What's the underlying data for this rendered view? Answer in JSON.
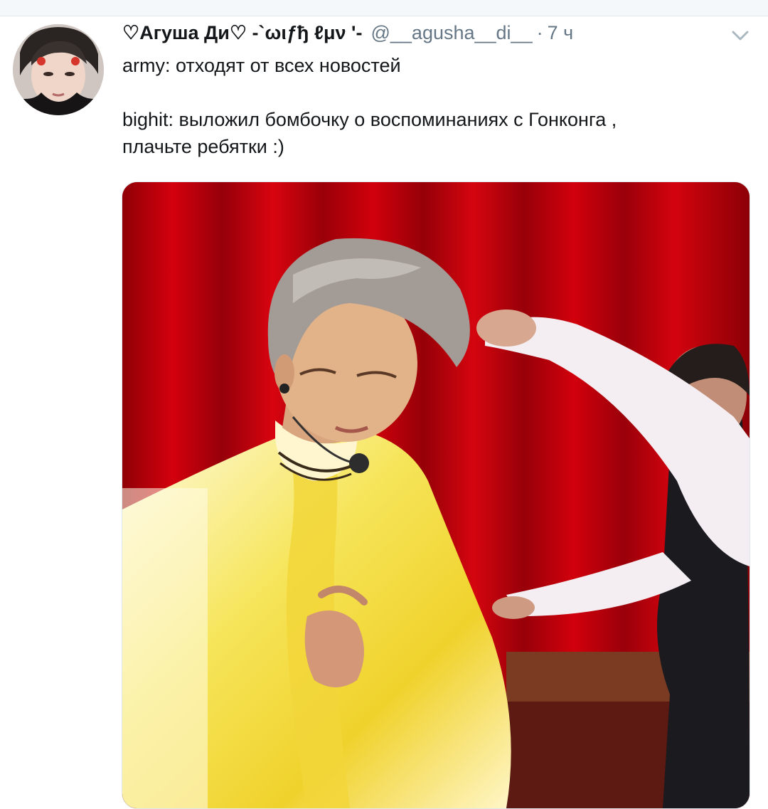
{
  "tweet": {
    "display_name": "♡Агуша Ди♡ -`ωιƒђ ℓμν '-",
    "handle": "@__agusha__di__",
    "separator": "·",
    "time": "7 ч",
    "text_line1": "army: отходят от всех новостей",
    "text_line2": "bighit: выложил бомбочку о воспоминаниях с Гонконга ,",
    "text_line3": "плачьте ребятки :)",
    "more_icon": "chevron-down-icon",
    "media_description_icon": "video-frame"
  },
  "colors": {
    "name": "#14171a",
    "secondary": "#657786",
    "curtain": "#b30008",
    "divider": "#e1e8ed"
  }
}
